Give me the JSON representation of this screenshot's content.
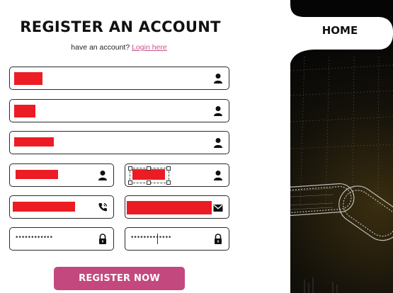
{
  "page": {
    "title": "REGISTER AN ACCOUNT",
    "subtitle_prefix": "have an account?",
    "login_link": "Login here"
  },
  "nav": {
    "home_label": "HOME"
  },
  "form": {
    "fields": [
      {
        "name": "full-name-field",
        "icon": "user-icon",
        "value": "redacted"
      },
      {
        "name": "username-field",
        "icon": "user-icon",
        "value": "redacted"
      },
      {
        "name": "address-field",
        "icon": "user-icon",
        "value": "redacted"
      },
      {
        "name": "last-name-field",
        "icon": "user-icon",
        "value": "redacted"
      },
      {
        "name": "first-name-field",
        "icon": "user-icon",
        "value": "redacted"
      },
      {
        "name": "phone-field",
        "icon": "phone-icon",
        "value": "redacted"
      },
      {
        "name": "email-field",
        "icon": "envelope-icon",
        "value": "redacted"
      },
      {
        "name": "password-field",
        "icon": "lock-icon",
        "value": "••••••••••••"
      },
      {
        "name": "confirm-password-field",
        "icon": "lock-icon",
        "value": "•••••••••••••"
      }
    ],
    "submit_label": "REGISTER NOW"
  },
  "colors": {
    "accent": "#c3487e",
    "link": "#c8508c",
    "redaction": "#ec1c24",
    "panel_dark": "#050505"
  }
}
